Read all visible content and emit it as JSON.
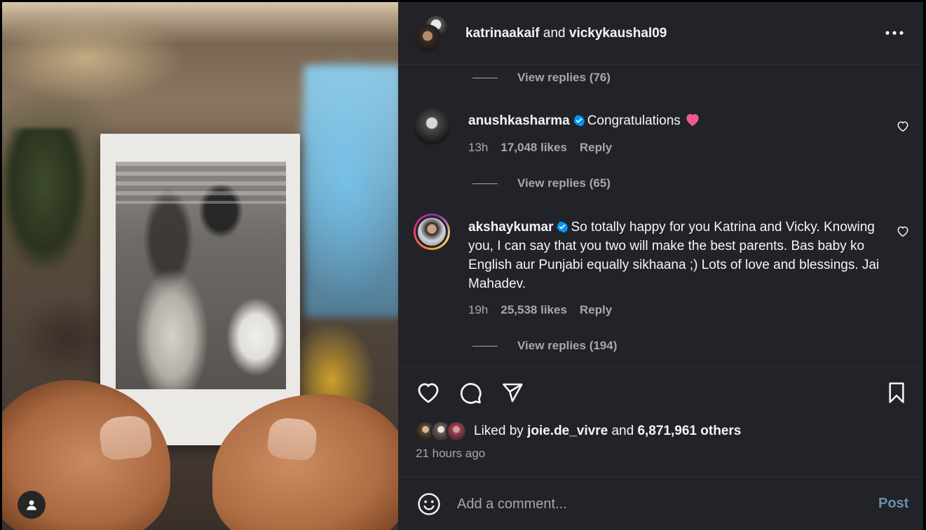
{
  "post": {
    "authors": [
      "katrinaakaif",
      "vickykaushal09"
    ],
    "authors_joiner": "and",
    "more_icon": "more-horizontal-icon"
  },
  "comments": {
    "top_view_replies": "View replies (76)",
    "items": [
      {
        "username": "anushkasharma",
        "verified": true,
        "text": "Congratulations",
        "emoji": "pink-heart",
        "age": "13h",
        "likes": "17,048 likes",
        "reply": "Reply",
        "view_replies": "View replies (65)"
      },
      {
        "username": "akshaykumar",
        "verified": true,
        "text": "So totally happy for you Katrina and Vicky. Knowing you, I can say that you two will make the best parents. Bas baby ko English aur Punjabi equally sikhaana ;) Lots of love and blessings. Jai Mahadev.",
        "age": "19h",
        "likes": "25,538 likes",
        "reply": "Reply",
        "view_replies": "View replies (194)"
      }
    ]
  },
  "engagement": {
    "liked_prefix": "Liked by",
    "liked_user": "joie.de_vivre",
    "liked_joiner": "and",
    "liked_others": "6,871,961 others",
    "timestamp": "21 hours ago"
  },
  "comment_bar": {
    "placeholder": "Add a comment...",
    "post_label": "Post"
  },
  "colors": {
    "panel_bg": "#212328",
    "text_primary": "#f5f5f5",
    "text_secondary": "#a8a8a8",
    "verified_blue": "#0095f6",
    "post_button_disabled": "#6b8fa8"
  }
}
